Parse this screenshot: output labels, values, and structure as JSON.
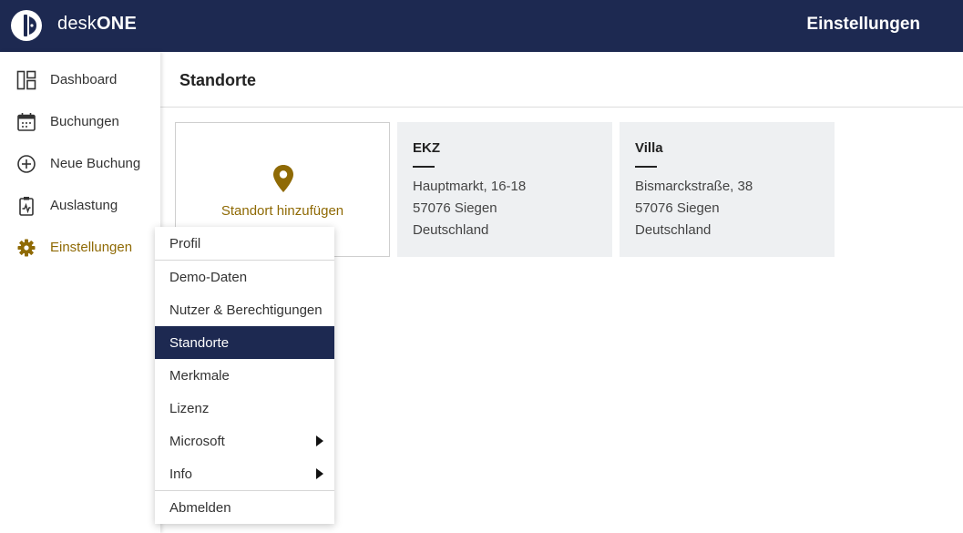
{
  "app": {
    "brand_prefix": "desk",
    "brand_suffix": "ONE",
    "page_heading": "Einstellungen"
  },
  "colors": {
    "navy": "#1d2951",
    "accent_gold": "#8f6a05",
    "card_bg": "#eef0f2"
  },
  "sidebar": {
    "items": [
      {
        "label": "Dashboard",
        "icon": "dashboard-icon"
      },
      {
        "label": "Buchungen",
        "icon": "calendar-icon"
      },
      {
        "label": "Neue Buchung",
        "icon": "plus-circle-icon"
      },
      {
        "label": "Auslastung",
        "icon": "clipboard-chart-icon"
      },
      {
        "label": "Einstellungen",
        "icon": "gear-icon",
        "active": true
      }
    ]
  },
  "content": {
    "title": "Standorte",
    "add_card_label": "Standort hinzufügen",
    "locations": [
      {
        "name": "EKZ",
        "street": "Hauptmarkt, 16-18",
        "city": "57076 Siegen",
        "country": "Deutschland"
      },
      {
        "name": "Villa",
        "street": "Bismarckstraße, 38",
        "city": "57076 Siegen",
        "country": "Deutschland"
      }
    ]
  },
  "settings_menu": {
    "items": [
      {
        "label": "Profil"
      },
      {
        "label": "Demo-Daten"
      },
      {
        "label": "Nutzer & Berechtigungen"
      },
      {
        "label": "Standorte",
        "selected": true
      },
      {
        "label": "Merkmale"
      },
      {
        "label": "Lizenz"
      },
      {
        "label": "Microsoft",
        "submenu": true
      },
      {
        "label": "Info",
        "submenu": true
      },
      {
        "label": "Abmelden"
      }
    ]
  }
}
